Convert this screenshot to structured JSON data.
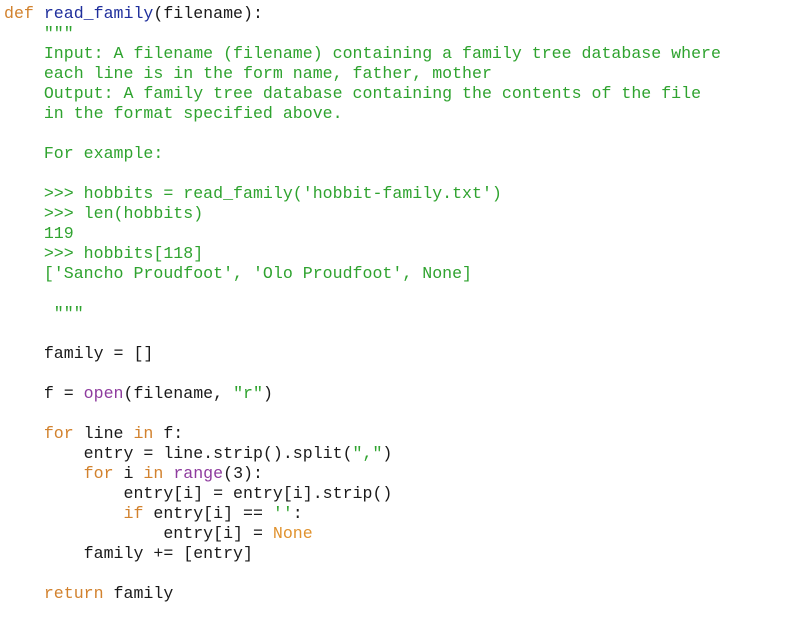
{
  "editor": {
    "language": "python",
    "colors": {
      "keyword": "#d2822e",
      "function_name": "#1f2f9c",
      "docstring": "#2fa32f",
      "string": "#2fa32f",
      "builtin": "#8e3c9e",
      "constant": "#e0922e",
      "text": "#1a1a1a",
      "background": "#ffffff"
    },
    "lines": [
      [
        {
          "t": "kw",
          "s": "def"
        },
        {
          "t": "plain",
          "s": " "
        },
        {
          "t": "fn",
          "s": "read_family"
        },
        {
          "t": "plain",
          "s": "(filename):"
        }
      ],
      [
        {
          "t": "doc",
          "s": "    \"\"\""
        }
      ],
      [
        {
          "t": "doc",
          "s": "    Input: A filename (filename) containing a family tree database where"
        }
      ],
      [
        {
          "t": "doc",
          "s": "    each line is in the form name, father, mother"
        }
      ],
      [
        {
          "t": "doc",
          "s": "    Output: A family tree database containing the contents of the file"
        }
      ],
      [
        {
          "t": "doc",
          "s": "    in the format specified above."
        }
      ],
      [],
      [
        {
          "t": "doc",
          "s": "    For example:"
        }
      ],
      [],
      [
        {
          "t": "doc",
          "s": "    >>> hobbits = read_family('hobbit-family.txt')"
        }
      ],
      [
        {
          "t": "doc",
          "s": "    >>> len(hobbits)"
        }
      ],
      [
        {
          "t": "doc",
          "s": "    119"
        }
      ],
      [
        {
          "t": "doc",
          "s": "    >>> hobbits[118]"
        }
      ],
      [
        {
          "t": "doc",
          "s": "    ['Sancho Proudfoot', 'Olo Proudfoot', None]"
        }
      ],
      [],
      [
        {
          "t": "doc",
          "s": "     \"\"\""
        }
      ],
      [],
      [
        {
          "t": "plain",
          "s": "    family = []"
        }
      ],
      [],
      [
        {
          "t": "plain",
          "s": "    f = "
        },
        {
          "t": "builtin",
          "s": "open"
        },
        {
          "t": "plain",
          "s": "(filename, "
        },
        {
          "t": "str",
          "s": "\"r\""
        },
        {
          "t": "plain",
          "s": ")"
        }
      ],
      [],
      [
        {
          "t": "kw",
          "s": "    for"
        },
        {
          "t": "plain",
          "s": " line "
        },
        {
          "t": "kw",
          "s": "in"
        },
        {
          "t": "plain",
          "s": " f:"
        }
      ],
      [
        {
          "t": "plain",
          "s": "        entry = line.strip().split("
        },
        {
          "t": "str",
          "s": "\",\""
        },
        {
          "t": "plain",
          "s": ")"
        }
      ],
      [
        {
          "t": "kw",
          "s": "        for"
        },
        {
          "t": "plain",
          "s": " i "
        },
        {
          "t": "kw",
          "s": "in"
        },
        {
          "t": "plain",
          "s": " "
        },
        {
          "t": "builtin",
          "s": "range"
        },
        {
          "t": "plain",
          "s": "(3):"
        }
      ],
      [
        {
          "t": "plain",
          "s": "            entry[i] = entry[i].strip()"
        }
      ],
      [
        {
          "t": "kw",
          "s": "            if"
        },
        {
          "t": "plain",
          "s": " entry[i] == "
        },
        {
          "t": "str",
          "s": "''"
        },
        {
          "t": "plain",
          "s": ":"
        }
      ],
      [
        {
          "t": "plain",
          "s": "                entry[i] = "
        },
        {
          "t": "const",
          "s": "None"
        }
      ],
      [
        {
          "t": "plain",
          "s": "        family += [entry]"
        }
      ],
      [],
      [
        {
          "t": "kw",
          "s": "    return"
        },
        {
          "t": "plain",
          "s": " family"
        }
      ]
    ]
  }
}
